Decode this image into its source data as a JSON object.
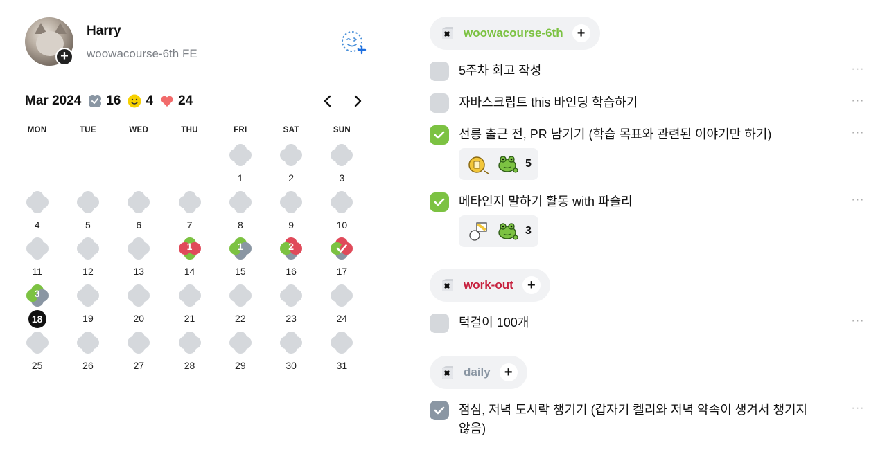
{
  "profile": {
    "name": "Harry",
    "subtitle": "woowacourse-6th FE"
  },
  "calendar": {
    "month_label": "Mar 2024",
    "stats": [
      {
        "icon": "check-badge-icon",
        "value": "16",
        "color": "#8a96a3"
      },
      {
        "icon": "smile-icon",
        "value": "4",
        "color": "#f7d100"
      },
      {
        "icon": "heart-icon",
        "value": "24",
        "color": "#f26b6b"
      }
    ],
    "weekdays": [
      "MON",
      "TUE",
      "WED",
      "THU",
      "FRI",
      "SAT",
      "SUN"
    ],
    "today": "18",
    "weeks": [
      [
        null,
        null,
        null,
        null,
        {
          "d": "1"
        },
        {
          "d": "2"
        },
        {
          "d": "3"
        }
      ],
      [
        {
          "d": "4"
        },
        {
          "d": "5"
        },
        {
          "d": "6"
        },
        {
          "d": "7"
        },
        {
          "d": "8"
        },
        {
          "d": "9"
        },
        {
          "d": "10"
        }
      ],
      [
        {
          "d": "11"
        },
        {
          "d": "12"
        },
        {
          "d": "13"
        },
        {
          "d": "14",
          "count": "1",
          "colors": [
            "#7cc242",
            "#7cc242",
            "#e04a5a",
            "#e04a5a"
          ]
        },
        {
          "d": "15",
          "count": "1",
          "colors": [
            "#7cc242",
            "#8a96a3",
            "#7cc242",
            "#8a96a3"
          ]
        },
        {
          "d": "16",
          "count": "2",
          "colors": [
            "#e04a5a",
            "#8a96a3",
            "#7cc242",
            "#e04a5a"
          ]
        },
        {
          "d": "17",
          "check": true,
          "colors": [
            "#e04a5a",
            "#8a96a3",
            "#7cc242",
            "#e04a5a"
          ]
        }
      ],
      [
        {
          "d": "18",
          "count": "3",
          "colors": [
            "#7cc242",
            "#8a96a3",
            "#7cc242",
            "#8a96a3"
          ]
        },
        {
          "d": "19"
        },
        {
          "d": "20"
        },
        {
          "d": "21"
        },
        {
          "d": "22"
        },
        {
          "d": "23"
        },
        {
          "d": "24"
        }
      ],
      [
        {
          "d": "25"
        },
        {
          "d": "26"
        },
        {
          "d": "27"
        },
        {
          "d": "28"
        },
        {
          "d": "29"
        },
        {
          "d": "30"
        },
        {
          "d": "31"
        }
      ]
    ]
  },
  "categories": [
    {
      "label": "woowacourse-6th",
      "color": "#7cc242",
      "todos": [
        {
          "text": "5주차 회고 작성",
          "state": "empty"
        },
        {
          "text": "자바스크립트 this 바인딩 학습하기",
          "state": "empty"
        },
        {
          "text": "선릉 출근 전, PR 남기기 (학습 목표와 관련된 이야기만 하기)",
          "state": "green",
          "reaction_count": "5"
        },
        {
          "text": "메타인지 말하기 활동 with 파슬리",
          "state": "green",
          "reaction_count": "3"
        }
      ]
    },
    {
      "label": "work-out",
      "color": "#c7223f",
      "todos": [
        {
          "text": "턱걸이 100개",
          "state": "empty"
        }
      ]
    },
    {
      "label": "daily",
      "color": "#8a96a3",
      "todos": [
        {
          "text": "점심, 저녁 도시락 챙기기 (갑자기 켈리와 저녁 약속이 생겨서 챙기지 않음)",
          "state": "gray"
        }
      ]
    }
  ],
  "more_label": "···",
  "add_label": "+"
}
